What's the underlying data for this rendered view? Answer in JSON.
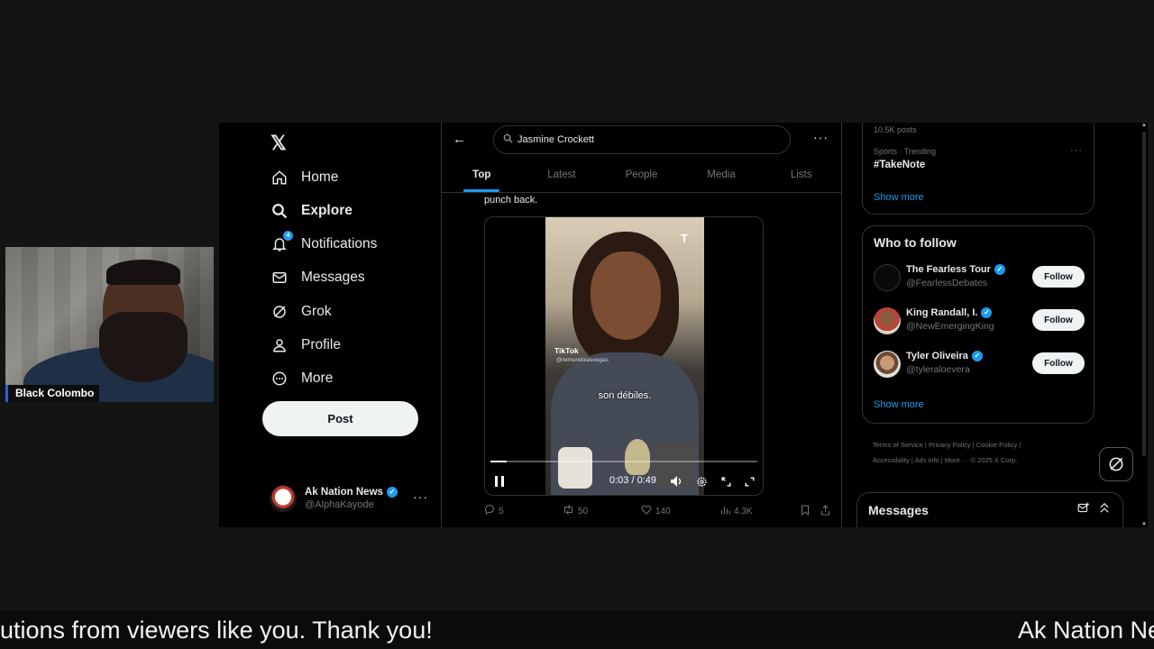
{
  "webcam": {
    "name": "Black Colombo"
  },
  "sidebar": {
    "logo": "𝕏",
    "items": [
      {
        "label": "Home",
        "icon": "home-icon"
      },
      {
        "label": "Explore",
        "icon": "search-icon"
      },
      {
        "label": "Notifications",
        "icon": "bell-icon",
        "badge": "4"
      },
      {
        "label": "Messages",
        "icon": "mail-icon"
      },
      {
        "label": "Grok",
        "icon": "grok-icon"
      },
      {
        "label": "Profile",
        "icon": "person-icon"
      },
      {
        "label": "More",
        "icon": "more-circle-icon"
      }
    ],
    "post_label": "Post",
    "account": {
      "name": "Ak Nation News",
      "handle": "@AlphaKayode"
    }
  },
  "center": {
    "search_value": "Jasmine Crockett",
    "tabs": [
      "Top",
      "Latest",
      "People",
      "Media",
      "Lists"
    ],
    "active_tab": "Top",
    "tweet_text": "punch back.",
    "video": {
      "tiktok_label": "TikTok",
      "tiktok_handle": "@remundolasvegas",
      "logo_letter": "T",
      "subtitle": "son débiles.",
      "time": "0:03 / 0:49",
      "progress": 0.06
    },
    "actions": {
      "replies": "5",
      "reposts": "50",
      "likes": "140",
      "views": "4.3K"
    }
  },
  "right": {
    "trend_posts": "10.5K posts",
    "trend_meta": "Sports · Trending",
    "trend_tag": "#TakeNote",
    "show_more": "Show more",
    "who_to_follow_title": "Who to follow",
    "follow_label": "Follow",
    "suggestions": [
      {
        "name": "The Fearless Tour",
        "handle": "@FearlessDebates"
      },
      {
        "name": "King Randall, I.",
        "handle": "@NewEmergingKing"
      },
      {
        "name": "Tyler Oliveira",
        "handle": "@tyleraloevera"
      }
    ],
    "footer_line1": "Terms of Service  |  Privacy Policy  |  Cookie Policy  |",
    "footer_line2": "Accessibility  |  Ads info  |  More ···  © 2025 X Corp.",
    "messages_title": "Messages"
  },
  "ticker": {
    "left_text": "utions from viewers like you. Thank you!",
    "right_text": "Ak Nation Ne"
  }
}
